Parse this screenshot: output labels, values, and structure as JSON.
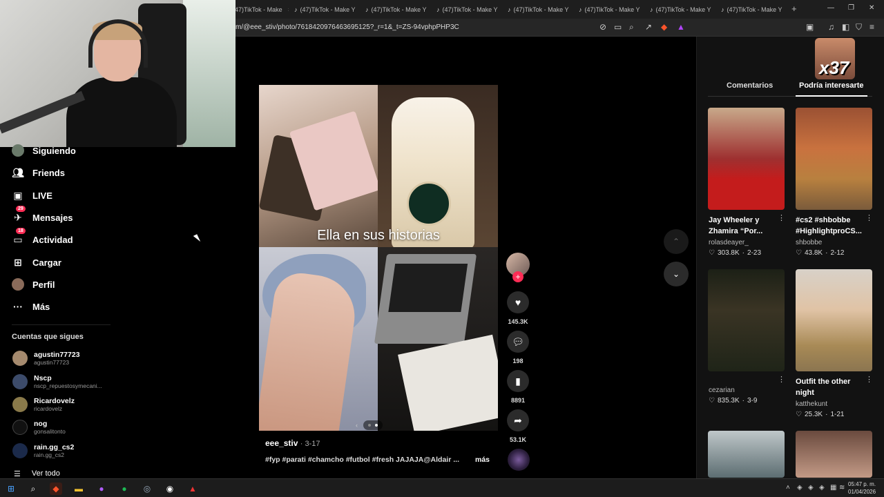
{
  "browser": {
    "tabs": [
      {
        "label": "47)TikTok - Make"
      },
      {
        "label": "(47)TikTok - Make Y"
      },
      {
        "label": "(47)TikTok - Make Y"
      },
      {
        "label": "(47)TikTok - Make Y"
      },
      {
        "label": "(47)TikTok - Make Y"
      },
      {
        "label": "(47)TikTok - Make Y"
      },
      {
        "label": "(47)TikTok - Make Y"
      },
      {
        "label": "(47)TikTok - Make Y"
      }
    ],
    "new_tab": "+",
    "url": "m/@eee_stiv/photo/7618420976463695125?_r=1&_t=ZS-94vphpPHP3C"
  },
  "sidebar": {
    "items": [
      {
        "label": "Siguiendo",
        "icon": "following-avatar-icon"
      },
      {
        "label": "Friends",
        "icon": "friends-icon"
      },
      {
        "label": "LIVE",
        "icon": "live-icon"
      },
      {
        "label": "Mensajes",
        "icon": "messages-icon",
        "badge": "29"
      },
      {
        "label": "Actividad",
        "icon": "activity-icon",
        "badge": "18"
      },
      {
        "label": "Cargar",
        "icon": "upload-icon"
      },
      {
        "label": "Perfil",
        "icon": "profile-avatar-icon"
      },
      {
        "label": "Más",
        "icon": "more-icon"
      }
    ],
    "following_title": "Cuentas que sigues",
    "accounts": [
      {
        "name": "agustin77723",
        "handle": "agustin77723"
      },
      {
        "name": "Nscp",
        "handle": "nscp_repuestosymecani..."
      },
      {
        "name": "Ricardovelz",
        "handle": "ricardovelz"
      },
      {
        "name": "nog",
        "handle": "gonsalitonto"
      },
      {
        "name": "rain.gg_cs2",
        "handle": "rain.gg_cs2"
      }
    ],
    "see_all": "Ver todo"
  },
  "video": {
    "overlay_text": "Ella en sus historias",
    "author": "eee_stiv",
    "date": "· 3-17",
    "caption": "#fyp #parati #chamcho #futbol #fresh JAJAJA@Aldair ...",
    "more": "más",
    "carousel_active": 2,
    "carousel_total": 2
  },
  "actions": {
    "plus": "+",
    "likes": "145.3K",
    "comments": "198",
    "saves": "8891",
    "shares": "53.1K"
  },
  "right_panel": {
    "badge": "x37",
    "tabs": [
      "Comentarios",
      "Podría interesarte"
    ],
    "active_tab": "Podría interesarte",
    "videos": [
      {
        "title": "Jay Wheeler y Zhamira “Por...",
        "author": "rolasdeayer_",
        "likes": "303.8K",
        "date": "2-23"
      },
      {
        "title": "#cs2 #shbobbe #HighlightproCS...",
        "author": "shbobbe",
        "likes": "43.8K",
        "date": "2-12"
      },
      {
        "title": "",
        "author": "cezarian",
        "likes": "835.3K",
        "date": "3-9"
      },
      {
        "title": "Outfit the other night",
        "author": "katthekunt",
        "likes": "25.3K",
        "date": "1-21"
      }
    ]
  },
  "taskbar": {
    "time": "05:47 p. m.",
    "date": "01/04/2026"
  },
  "colors": {
    "accent": "#fe2c55",
    "background": "#000000",
    "panel": "#121212"
  }
}
